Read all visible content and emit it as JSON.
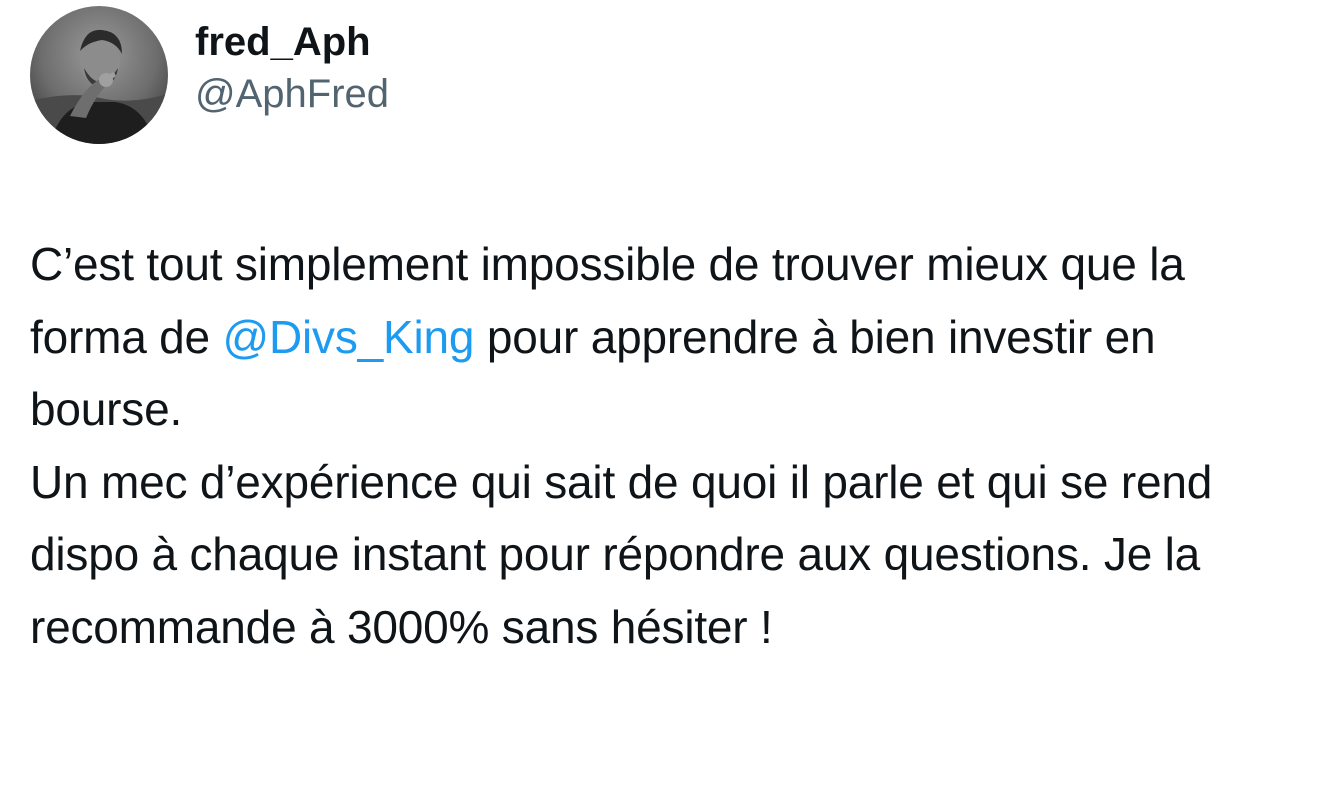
{
  "author": {
    "display_name": "fred_Aph",
    "handle": "@AphFred",
    "avatar_icon": "profile-photo-grayscale"
  },
  "tweet": {
    "line1_before_mention": "C’est tout simplement impossible de trouver mieux que la forma de ",
    "mention": "@Divs_King",
    "line1_after_mention": " pour apprendre à bien investir en bourse.",
    "line2": "Un mec d’expérience qui sait de quoi il parle et qui se rend dispo à chaque instant pour répondre aux questions. Je la recommande à 3000% sans hésiter !"
  },
  "colors": {
    "text": "#0f1419",
    "secondary_text": "#536471",
    "link": "#1d9bf0",
    "background": "#ffffff"
  }
}
